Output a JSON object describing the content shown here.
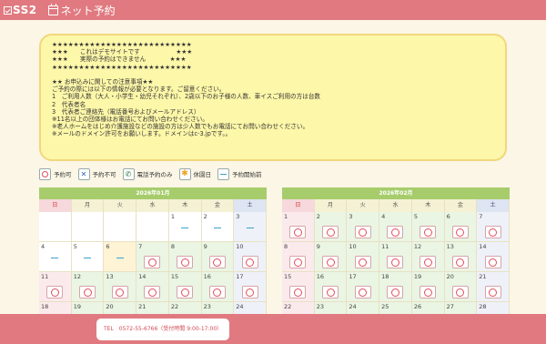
{
  "header": {
    "logo_text": "SS2",
    "app_title": "ネット予約"
  },
  "notice": {
    "text": "★★★★★★★★★★★★★★★★★★★★★★★★★★\n★★★　　これはデモサイトです　　　　　　★★★\n★★★　　実際の予約はできません　　　　★★★\n★★★★★★★★★★★★★★★★★★★★★★★★★★\n\n★★ お申込みに関しての注意事項★★\nご予約の際には以下の情報が必要となります。ご留意ください。\n1　ご利用人数（大人・小学生・幼児それぞれ）、2歳以下のお子様の人数、車イスご利用の方は台数\n2　代表者名\n3　代表者ご連絡先（電話番号およびメールアドレス）\n※11名以上の団体様はお電話にてお問い合わせください。\n※老人ホームをはじめ介護施設などの施設の方は少人数でもお電話にてお問い合わせください。\n※メールのドメイン許可をお願いします。ドメインはc-3.jpです。。"
  },
  "legend": [
    {
      "icon": "circle-icon",
      "label": "予約可"
    },
    {
      "icon": "cross-icon",
      "label": "予約不可"
    },
    {
      "icon": "phone-icon",
      "label": "電話予約のみ"
    },
    {
      "icon": "star-icon",
      "label": "休園日"
    },
    {
      "icon": "dash-icon",
      "label": "予約開始前"
    }
  ],
  "colors": {
    "header": "#e07a80",
    "calendar_title": "#a7cc6c",
    "notice_bg": "#fdf7a9",
    "available": "#e24d5a",
    "before_open": "#3aa1cc"
  },
  "calendars": [
    {
      "title": "2026年01月",
      "dow": [
        "日",
        "月",
        "火",
        "水",
        "木",
        "金",
        "土"
      ],
      "cells": [
        {
          "d": "",
          "m": "",
          "c": "empty"
        },
        {
          "d": "",
          "m": "",
          "c": "empty"
        },
        {
          "d": "",
          "m": "",
          "c": "empty"
        },
        {
          "d": "",
          "m": "",
          "c": "empty"
        },
        {
          "d": "1",
          "m": "dash",
          "c": ""
        },
        {
          "d": "2",
          "m": "dash",
          "c": ""
        },
        {
          "d": "3",
          "m": "dash",
          "c": "sat"
        },
        {
          "d": "4",
          "m": "dash",
          "c": "pre"
        },
        {
          "d": "5",
          "m": "dash",
          "c": "pre"
        },
        {
          "d": "6",
          "m": "dash",
          "c": "hl"
        },
        {
          "d": "7",
          "m": "circle",
          "c": "wk"
        },
        {
          "d": "8",
          "m": "circle",
          "c": "wk"
        },
        {
          "d": "9",
          "m": "circle",
          "c": "wk"
        },
        {
          "d": "10",
          "m": "circle",
          "c": "wk sat"
        },
        {
          "d": "11",
          "m": "circle",
          "c": "wk sun"
        },
        {
          "d": "12",
          "m": "circle",
          "c": "wk"
        },
        {
          "d": "13",
          "m": "circle",
          "c": "wk"
        },
        {
          "d": "14",
          "m": "circle",
          "c": "wk"
        },
        {
          "d": "15",
          "m": "circle",
          "c": "wk"
        },
        {
          "d": "16",
          "m": "circle",
          "c": "wk"
        },
        {
          "d": "17",
          "m": "circle",
          "c": "wk sat"
        },
        {
          "d": "18",
          "m": "",
          "c": "wk sun"
        },
        {
          "d": "19",
          "m": "",
          "c": "wk"
        },
        {
          "d": "20",
          "m": "",
          "c": "wk"
        },
        {
          "d": "21",
          "m": "",
          "c": "wk"
        },
        {
          "d": "22",
          "m": "",
          "c": "wk"
        },
        {
          "d": "23",
          "m": "",
          "c": "wk"
        },
        {
          "d": "24",
          "m": "",
          "c": "wk sat"
        }
      ]
    },
    {
      "title": "2026年02月",
      "dow": [
        "日",
        "月",
        "火",
        "水",
        "木",
        "金",
        "土"
      ],
      "cells": [
        {
          "d": "1",
          "m": "circle",
          "c": "wk sun"
        },
        {
          "d": "2",
          "m": "circle",
          "c": "wk"
        },
        {
          "d": "3",
          "m": "circle",
          "c": "wk"
        },
        {
          "d": "4",
          "m": "circle",
          "c": "wk"
        },
        {
          "d": "5",
          "m": "circle",
          "c": "wk"
        },
        {
          "d": "6",
          "m": "circle",
          "c": "wk"
        },
        {
          "d": "7",
          "m": "circle",
          "c": "wk sat"
        },
        {
          "d": "8",
          "m": "circle",
          "c": "wk sun"
        },
        {
          "d": "9",
          "m": "circle",
          "c": "wk"
        },
        {
          "d": "10",
          "m": "circle",
          "c": "wk"
        },
        {
          "d": "11",
          "m": "circle",
          "c": "wk"
        },
        {
          "d": "12",
          "m": "circle",
          "c": "wk"
        },
        {
          "d": "13",
          "m": "circle",
          "c": "wk"
        },
        {
          "d": "14",
          "m": "circle",
          "c": "wk sat"
        },
        {
          "d": "15",
          "m": "circle",
          "c": "wk sun"
        },
        {
          "d": "16",
          "m": "circle",
          "c": "wk"
        },
        {
          "d": "17",
          "m": "circle",
          "c": "wk"
        },
        {
          "d": "18",
          "m": "circle",
          "c": "wk"
        },
        {
          "d": "19",
          "m": "circle",
          "c": "wk"
        },
        {
          "d": "20",
          "m": "circle",
          "c": "wk"
        },
        {
          "d": "21",
          "m": "circle",
          "c": "wk sat"
        },
        {
          "d": "22",
          "m": "",
          "c": "wk sun"
        },
        {
          "d": "23",
          "m": "",
          "c": "wk"
        },
        {
          "d": "24",
          "m": "",
          "c": "wk"
        },
        {
          "d": "25",
          "m": "",
          "c": "wk"
        },
        {
          "d": "26",
          "m": "",
          "c": "wk"
        },
        {
          "d": "27",
          "m": "",
          "c": "wk"
        },
        {
          "d": "28",
          "m": "",
          "c": "wk sat"
        }
      ]
    }
  ],
  "footer": {
    "tel": "TEL　0572-55-6766（受付時間 9:00-17:00）"
  }
}
